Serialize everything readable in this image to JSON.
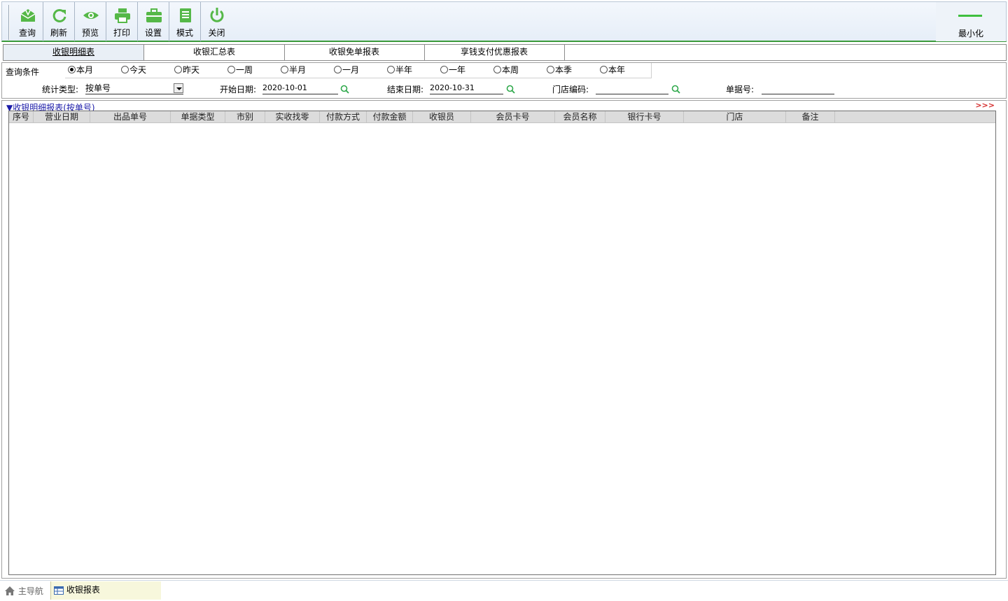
{
  "toolbar": {
    "buttons": [
      {
        "label": "查询",
        "icon": "query-icon"
      },
      {
        "label": "刷新",
        "icon": "refresh-icon"
      },
      {
        "label": "预览",
        "icon": "preview-icon"
      },
      {
        "label": "打印",
        "icon": "print-icon"
      },
      {
        "label": "设置",
        "icon": "settings-icon"
      },
      {
        "label": "模式",
        "icon": "mode-icon"
      },
      {
        "label": "关闭",
        "icon": "power-icon"
      }
    ],
    "minimize_label": "最小化",
    "accent_color": "#3fbf3f"
  },
  "tabs": [
    {
      "label": "收银明细表",
      "active": true
    },
    {
      "label": "收银汇总表",
      "active": false
    },
    {
      "label": "收银免单报表",
      "active": false
    },
    {
      "label": "享钱支付优惠报表",
      "active": false
    }
  ],
  "query": {
    "label": "查询条件",
    "ranges": [
      "本月",
      "今天",
      "昨天",
      "一周",
      "半月",
      "一月",
      "半年",
      "一年",
      "本周",
      "本季",
      "本年"
    ],
    "selected_range": "本月",
    "stat_type_label": "统计类型:",
    "stat_type_value": "按单号",
    "start_date_label": "开始日期:",
    "start_date_value": "2020-10-01",
    "end_date_label": "结束日期:",
    "end_date_value": "2020-10-31",
    "store_code_label": "门店编码:",
    "store_code_value": "",
    "bill_no_label": "单据号:",
    "bill_no_value": ""
  },
  "report": {
    "title": "▼收银明细报表(按单号)",
    "more": ">>>",
    "columns": [
      "序号",
      "营业日期",
      "出品单号",
      "单据类型",
      "市别",
      "实收找零",
      "付款方式",
      "付款金额",
      "收银员",
      "会员卡号",
      "会员名称",
      "银行卡号",
      "门店",
      "备注"
    ],
    "rows": []
  },
  "statusbar": {
    "home_label": "主导航",
    "open_tab_label": "收银报表"
  }
}
